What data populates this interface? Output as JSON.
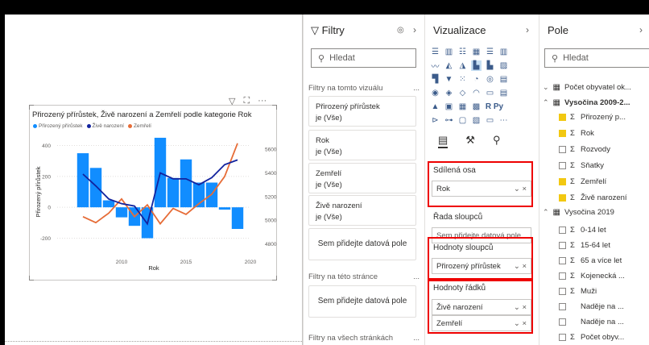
{
  "visual": {
    "title": "Přirozený přírůstek, Živě narození a Zemřelí podle kategorie Rok",
    "legend": [
      {
        "name": "Přirozený přírůstek",
        "color": "#118dff"
      },
      {
        "name": "Živě narození",
        "color": "#12239e"
      },
      {
        "name": "Zemřelí",
        "color": "#e66c37"
      }
    ],
    "header_icons": [
      "filter-icon",
      "focus-icon",
      "more-options-icon"
    ]
  },
  "chart_data": {
    "type": "bar",
    "xlabel": "Rok",
    "ylabel": "Přirozený přírůstek",
    "x": [
      2007,
      2008,
      2009,
      2010,
      2011,
      2012,
      2013,
      2014,
      2015,
      2016,
      2017,
      2018,
      2019
    ],
    "xticks": [
      "2010",
      "2015",
      "2020"
    ],
    "xlim": [
      2005,
      2020
    ],
    "yticks_left": [
      "400",
      "200",
      "0",
      "-200"
    ],
    "ylim_left": [
      -260,
      460
    ],
    "yticks_right": [
      "5600",
      "5400",
      "5200",
      "5000",
      "4800"
    ],
    "ylim_right": [
      4770,
      5710
    ],
    "series": [
      {
        "name": "Přirozený přírůstek",
        "axis": "left",
        "type": "bar",
        "values": [
          350,
          255,
          45,
          -65,
          -120,
          -200,
          450,
          190,
          310,
          160,
          160,
          -15,
          -140
        ]
      },
      {
        "name": "Živě narození",
        "axis": "right",
        "type": "line",
        "values": [
          5390,
          5290,
          5180,
          5140,
          5120,
          4970,
          5400,
          5350,
          5350,
          5300,
          5360,
          5470,
          5510
        ]
      },
      {
        "name": "Zemřelí",
        "axis": "right",
        "type": "line",
        "values": [
          5030,
          4980,
          5060,
          5180,
          5030,
          5130,
          4970,
          5100,
          5050,
          5140,
          5220,
          5370,
          5650
        ]
      }
    ]
  },
  "canvas_header": {
    "more": "···"
  },
  "filters": {
    "title": "Filtry",
    "search_placeholder": "Hledat",
    "on_visual": "Filtry na tomto vizuálu",
    "cards": [
      {
        "name": "Přirozený přírůstek",
        "value": "je (Vše)"
      },
      {
        "name": "Rok",
        "value": "je (Vše)"
      },
      {
        "name": "Zemřelí",
        "value": "je (Vše)"
      },
      {
        "name": "Živě narození",
        "value": "je (Vše)"
      }
    ],
    "add_field": "Sem přidejte datová pole",
    "on_page": "Filtry na této stránce",
    "add_field_page": "Sem přidejte datová pole",
    "on_all": "Filtry na všech stránkách",
    "more": "..."
  },
  "viz": {
    "title": "Vizualizace",
    "shared_axis": "Sdílená osa",
    "shared_axis_value": "Rok",
    "column_series": "Řada sloupců",
    "column_series_placeholder": "Sem přidejte datová pole",
    "column_values": "Hodnoty sloupců",
    "column_values_value": "Přirozený přírůstek",
    "line_values": "Hodnoty řádků",
    "line_values_items": [
      "Živě narození",
      "Zemřelí"
    ],
    "icon_text": "R Py"
  },
  "fields": {
    "title": "Pole",
    "search_placeholder": "Hledat",
    "tables": [
      {
        "name": "Počet obyvatel ok...",
        "expanded": false,
        "y": 103
      },
      {
        "name": "Vysočina 2009-2...",
        "expanded": true,
        "y": 122,
        "bold": true
      },
      {
        "name": "Vysočina 2019",
        "expanded": true,
        "y": 258
      }
    ],
    "items": [
      {
        "label": "Přirozený p...",
        "checked": true,
        "sigma": true
      },
      {
        "label": "Rok",
        "checked": true,
        "sigma": true
      },
      {
        "label": "Rozvody",
        "checked": false,
        "sigma": true
      },
      {
        "label": "Sňatky",
        "checked": false,
        "sigma": true
      },
      {
        "label": "Zemřelí",
        "checked": true,
        "sigma": true
      },
      {
        "label": "Živě narození",
        "checked": true,
        "sigma": true
      },
      {
        "label": "0-14 let",
        "checked": false,
        "sigma": true
      },
      {
        "label": "15-64 let",
        "checked": false,
        "sigma": true
      },
      {
        "label": "65 a více let",
        "checked": false,
        "sigma": true
      },
      {
        "label": "Kojenecká ...",
        "checked": false,
        "sigma": true
      },
      {
        "label": "Muži",
        "checked": false,
        "sigma": true
      },
      {
        "label": "Naděje na ...",
        "checked": false,
        "sigma": false
      },
      {
        "label": "Naděje na ...",
        "checked": false,
        "sigma": false
      },
      {
        "label": "Počet obyv...",
        "checked": false,
        "sigma": true
      }
    ]
  }
}
